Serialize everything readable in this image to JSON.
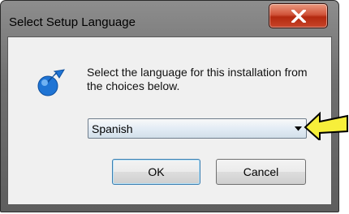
{
  "window": {
    "title": "Select Setup Language"
  },
  "dialog": {
    "icon": "setup-arrow-icon",
    "message": "Select the language for this installation from the choices below.",
    "language_select": {
      "value": "Spanish"
    },
    "buttons": {
      "ok": "OK",
      "cancel": "Cancel"
    }
  },
  "annotation": {
    "icon": "yellow-pointer-arrow",
    "color": "#f7ef3a"
  },
  "colors": {
    "close_button": "#c94128",
    "icon_blue": "#1f74d4"
  }
}
